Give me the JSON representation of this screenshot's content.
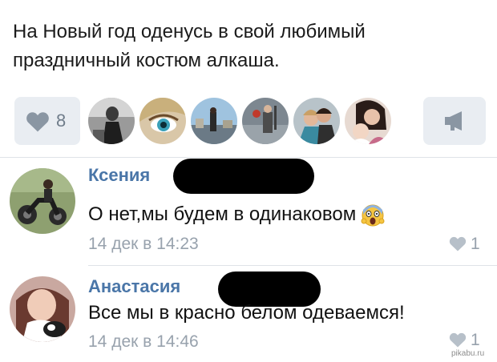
{
  "post": {
    "text_line1": "На Новый год оденусь в свой любимый",
    "text_line2": "праздничный костюм алкаша."
  },
  "likes": {
    "icon": "heart-icon",
    "count": "8",
    "avatars": [
      "liker-avatar-1",
      "liker-avatar-2",
      "liker-avatar-3",
      "liker-avatar-4",
      "liker-avatar-5",
      "liker-avatar-6"
    ]
  },
  "share": {
    "icon": "megaphone-icon"
  },
  "comments": [
    {
      "author": "Ксения",
      "text": "О нет,мы будем в одинаковом",
      "emoji": "scream-emoji",
      "date": "14 дек в 14:23",
      "likes": "1"
    },
    {
      "author": "Анастасия",
      "text": "Все мы в красно белом одеваемся!",
      "date": "14 дек в 14:46",
      "likes": "1"
    }
  ],
  "watermark": "pikabu.ru",
  "colors": {
    "link_blue": "#4a76a8",
    "button_bg": "#e9edf2",
    "meta_gray": "#98a2ad",
    "redaction": "#000000"
  }
}
